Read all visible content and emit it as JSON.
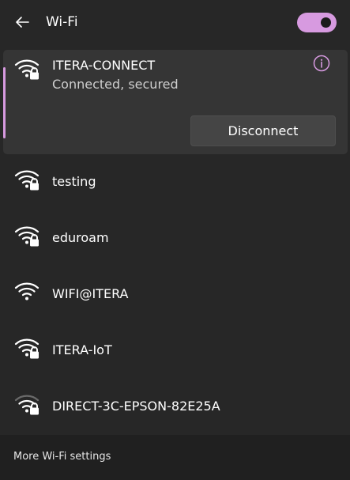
{
  "header": {
    "back_icon": "back-arrow-icon",
    "title": "Wi-Fi",
    "toggle_on": true,
    "accent_color": "#d79ae0"
  },
  "connected": {
    "name": "ITERA-CONNECT",
    "status": "Connected, secured",
    "disconnect_label": "Disconnect",
    "icon": "wifi-secured-icon"
  },
  "networks": [
    {
      "name": "testing",
      "icon": "wifi-secured-icon",
      "secured": true
    },
    {
      "name": "eduroam",
      "icon": "wifi-secured-icon",
      "secured": true
    },
    {
      "name": "WIFI@ITERA",
      "icon": "wifi-icon",
      "secured": false
    },
    {
      "name": "ITERA-IoT",
      "icon": "wifi-secured-icon",
      "secured": true
    },
    {
      "name": "DIRECT-3C-EPSON-82E25A",
      "icon": "wifi-weak-secured-icon",
      "secured": true
    }
  ],
  "footer": {
    "more_settings": "More Wi-Fi settings"
  }
}
